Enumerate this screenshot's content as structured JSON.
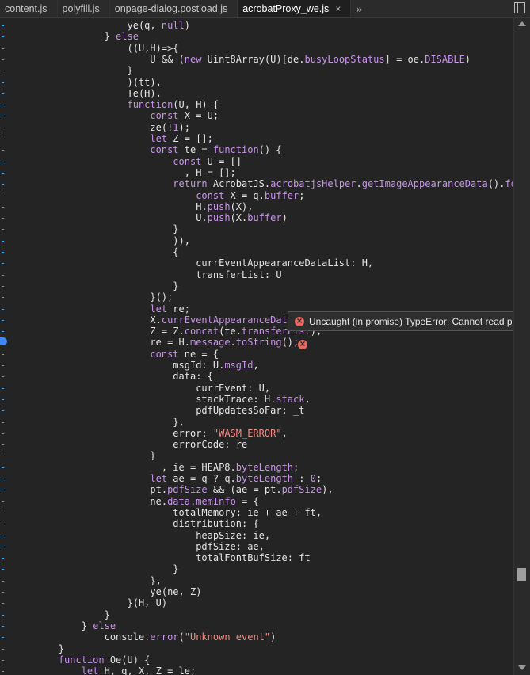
{
  "tabs": [
    {
      "label": "content.js",
      "active": false
    },
    {
      "label": "polyfill.js",
      "active": false
    },
    {
      "label": "onpage-dialog.postload.js",
      "active": false
    },
    {
      "label": "acrobatProxy_we.js",
      "active": true
    }
  ],
  "tab_close": "×",
  "tabs_more": "»",
  "gutter_mark": "-",
  "error": {
    "message": "Uncaught (in promise) TypeError: Cannot read prope",
    "icon_glyph": "×",
    "color": "#e46962"
  },
  "code_lines": [
    "                    ye(q, null)",
    "                } else",
    "                    ((U,H)=>{",
    "                        U && (new Uint8Array(U)[de.busyLoopStatus] = oe.DISABLE)",
    "                    }",
    "                    )(tt),",
    "                    Te(H),",
    "                    function(U, H) {",
    "                        const X = U;",
    "                        ze(!1);",
    "                        let Z = [];",
    "                        const te = function() {",
    "                            const U = []",
    "                              , H = [];",
    "                            return AcrobatJS.acrobatjsHelper.getImageAppearanceData().forEac",
    "                                const X = q.buffer;",
    "                                H.push(X),",
    "                                U.push(X.buffer)",
    "                            }",
    "                            )),",
    "                            {",
    "                                currEventAppearanceDataList: H,",
    "                                transferList: U",
    "                            }",
    "                        }();",
    "                        let re;",
    "                        X.currEventAppearanceData",
    "                        Z = Z.concat(te.transferList),",
    "                        re = H.message.toString();",
    "                        const ne = {",
    "                            msgId: U.msgId,",
    "                            data: {",
    "                                currEvent: U,",
    "                                stackTrace: H.stack,",
    "                                pdfUpdatesSoFar: _t",
    "                            },",
    "                            error: \"WASM_ERROR\",",
    "                            errorCode: re",
    "                        }",
    "                          , ie = HEAP8.byteLength;",
    "                        let ae = q ? q.byteLength : 0;",
    "                        pt.pdfSize && (ae = pt.pdfSize),",
    "                        ne.data.memInfo = {",
    "                            totalMemory: ie + ae + ft,",
    "                            distribution: {",
    "                                heapSize: ie,",
    "                                pdfSize: ae,",
    "                                totalFontBufSize: ft",
    "                            }",
    "                        },",
    "                        ye(ne, Z)",
    "                    }(H, U)",
    "                }",
    "            } else",
    "                console.error(\"Unknown event\")",
    "        }",
    "        function Oe(U) {",
    "            let H, q, X, Z = le;"
  ]
}
